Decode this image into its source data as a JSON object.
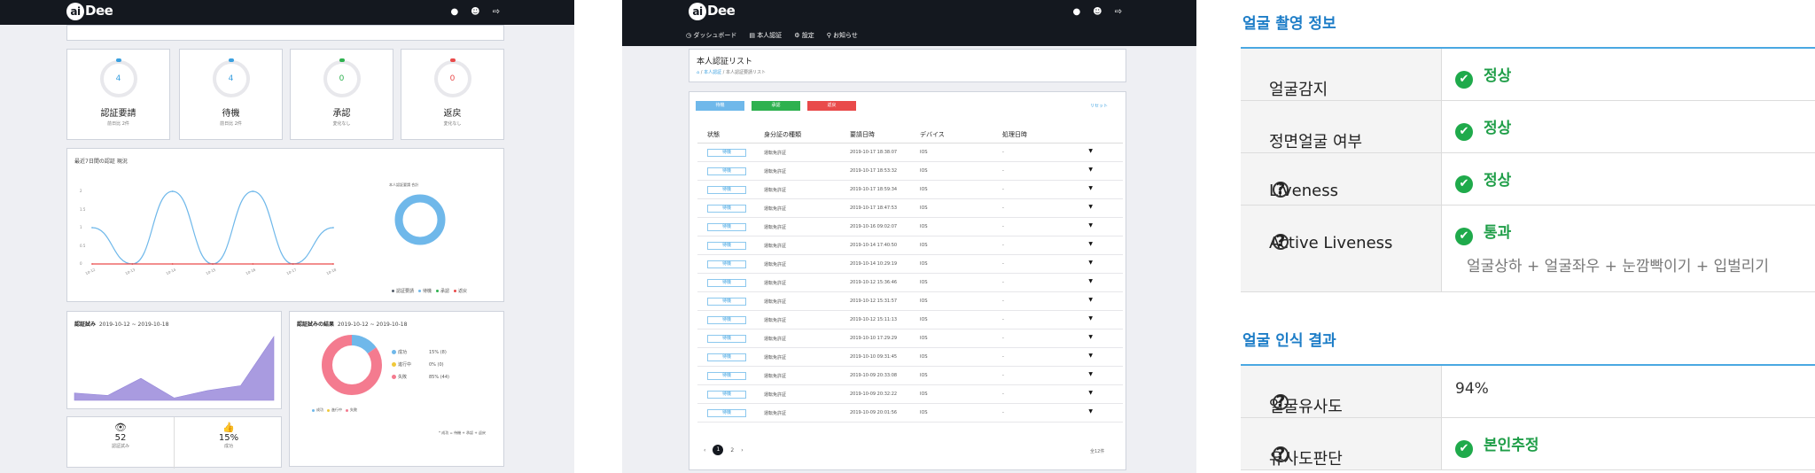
{
  "brand": "aiDee",
  "dashboard": {
    "stats": [
      {
        "value": "4",
        "label": "認証要請",
        "sub": "前日比 2件",
        "color": "#3aa0e0"
      },
      {
        "value": "4",
        "label": "待機",
        "sub": "前日比 2件",
        "color": "#3aa0e0"
      },
      {
        "value": "0",
        "label": "承認",
        "sub": "変化なし",
        "color": "#2eb14f"
      },
      {
        "value": "0",
        "label": "返戻",
        "sub": "変化なし",
        "color": "#e94a4a"
      }
    ],
    "trend_title": "最近7日間の認証 現況",
    "donut_label": "本人認証要請 合計",
    "legend": [
      {
        "label": "認証要請",
        "color": "#555e6a"
      },
      {
        "label": "待機",
        "color": "#6fb8ea"
      },
      {
        "label": "承認",
        "color": "#2eb14f"
      },
      {
        "label": "返戻",
        "color": "#e94a4a"
      }
    ],
    "attempts_title": "認証試み",
    "attempts_range": "2019-10-12 ~ 2019-10-18",
    "results_title": "認証試みの結果",
    "results_range": "2019-10-12 ~ 2019-10-18",
    "results_legend": [
      {
        "label": "成功",
        "pct": "15% (8)",
        "color": "#6fb8ea"
      },
      {
        "label": "進行中",
        "pct": "0% (0)",
        "color": "#f0c93a"
      },
      {
        "label": "失敗",
        "pct": "85% (44)",
        "color": "#f47b8f"
      }
    ],
    "results_note": "* 成功 = 待機 + 承認 + 返戻",
    "views": {
      "value": "52",
      "label": "認証試み"
    },
    "rate": {
      "value": "15%",
      "label": "成功"
    }
  },
  "chart_data": [
    {
      "type": "line",
      "title": "最近7日間の認証 現況",
      "x": [
        "10-12",
        "10-13",
        "10-14",
        "10-15",
        "10-16",
        "10-17",
        "10-18"
      ],
      "series": [
        {
          "name": "待機",
          "values": [
            1,
            0,
            2,
            0,
            2,
            0,
            1
          ]
        },
        {
          "name": "返戻",
          "values": [
            0,
            0,
            0,
            0,
            0,
            0,
            0
          ]
        }
      ],
      "ylim": [
        0,
        2
      ],
      "yticks": [
        "0",
        "0.5",
        "1",
        "1.5",
        "2"
      ]
    },
    {
      "type": "area",
      "title": "認証試み",
      "values": [
        3,
        2,
        9,
        1,
        4,
        6,
        26
      ]
    },
    {
      "type": "pie",
      "title": "認証試みの結果",
      "categories": [
        "成功",
        "進行中",
        "失敗"
      ],
      "values": [
        15,
        0,
        85
      ]
    }
  ],
  "list": {
    "nav": [
      "ダッシュボード",
      "本人認証",
      "設定",
      "お知らせ"
    ],
    "title": "本人認証リスト",
    "breadcrumb": [
      "本人認証",
      "本人認証要請リスト"
    ],
    "buttons": [
      {
        "label": "待機",
        "color": "#6fb8ea"
      },
      {
        "label": "承認",
        "color": "#2eb14f"
      },
      {
        "label": "返戻",
        "color": "#e94a4a"
      }
    ],
    "reset": "リセット",
    "headers": [
      "状態",
      "身分証の種類",
      "要請日時",
      "デバイス",
      "処理日時"
    ],
    "rows": [
      {
        "status": "待機",
        "type": "運転免許証",
        "date": "2019-10-17 18:38:07",
        "device": "IOS",
        "proc": "-"
      },
      {
        "status": "待機",
        "type": "運転免許証",
        "date": "2019-10-17 18:53:32",
        "device": "IOS",
        "proc": "-"
      },
      {
        "status": "待機",
        "type": "運転免許証",
        "date": "2019-10-17 18:59:34",
        "device": "IOS",
        "proc": "-"
      },
      {
        "status": "待機",
        "type": "運転免許証",
        "date": "2019-10-17 18:47:53",
        "device": "IOS",
        "proc": "-"
      },
      {
        "status": "待機",
        "type": "運転免許証",
        "date": "2019-10-16 09:02:07",
        "device": "IOS",
        "proc": "-"
      },
      {
        "status": "待機",
        "type": "運転免許証",
        "date": "2019-10-14 17:40:50",
        "device": "IOS",
        "proc": "-"
      },
      {
        "status": "待機",
        "type": "運転免許証",
        "date": "2019-10-14 10:29:19",
        "device": "IOS",
        "proc": "-"
      },
      {
        "status": "待機",
        "type": "運転免許証",
        "date": "2019-10-12 15:36:46",
        "device": "IOS",
        "proc": "-"
      },
      {
        "status": "待機",
        "type": "運転免許証",
        "date": "2019-10-12 15:31:57",
        "device": "IOS",
        "proc": "-"
      },
      {
        "status": "待機",
        "type": "運転免許証",
        "date": "2019-10-12 15:11:13",
        "device": "IOS",
        "proc": "-"
      },
      {
        "status": "待機",
        "type": "運転免許証",
        "date": "2019-10-10 17:29:29",
        "device": "IOS",
        "proc": "-"
      },
      {
        "status": "待機",
        "type": "運転免許証",
        "date": "2019-10-10 09:31:45",
        "device": "IOS",
        "proc": "-"
      },
      {
        "status": "待機",
        "type": "運転免許証",
        "date": "2019-10-09 20:33:08",
        "device": "IOS",
        "proc": "-"
      },
      {
        "status": "待機",
        "type": "運転免許証",
        "date": "2019-10-09 20:32:22",
        "device": "IOS",
        "proc": "-"
      },
      {
        "status": "待機",
        "type": "運転免許証",
        "date": "2019-10-09 20:01:56",
        "device": "IOS",
        "proc": "-"
      }
    ],
    "pages": [
      "1",
      "2"
    ],
    "count": "全12件"
  },
  "detail": {
    "section1": "얼굴 촬영 정보",
    "rows1": [
      {
        "label": "얼굴감지",
        "help": false,
        "value": "정상",
        "desc": ""
      },
      {
        "label": "정면얼굴 여부",
        "help": false,
        "value": "정상",
        "desc": ""
      },
      {
        "label": "Liveness",
        "help": true,
        "value": "정상",
        "desc": ""
      },
      {
        "label": "Active Liveness",
        "help": true,
        "value": "통과",
        "desc": "얼굴상하 + 얼굴좌우 + 눈깜빡이기 + 입벌리기"
      }
    ],
    "section2": "얼굴 인식 결과",
    "rows2": [
      {
        "label": "얼굴유사도",
        "help": true,
        "value": "94%",
        "check": false
      },
      {
        "label": "유사도판단",
        "help": true,
        "value": "본인추정",
        "check": true
      }
    ]
  }
}
